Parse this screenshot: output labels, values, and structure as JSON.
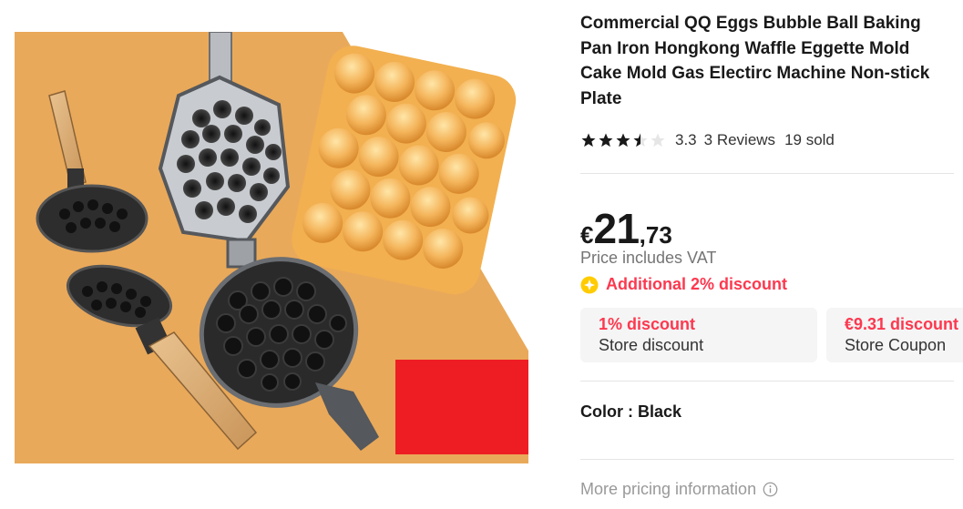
{
  "product": {
    "title": "Commercial QQ Eggs Bubble Ball Baking Pan Iron Hongkong Waffle Eggette Mold Cake Mold Gas Electirc Machine Non-stick Plate",
    "image_icon": "bubble-waffle-pan-photo"
  },
  "rating": {
    "value": "3.3",
    "stars": 3.3,
    "reviews": "3 Reviews",
    "sold": "19 sold",
    "star_color": "#191919",
    "empty_star_color": "#e6e6e6"
  },
  "price": {
    "currency": "€",
    "integer": "21",
    "decimal": ",73",
    "vat_note": "Price includes VAT"
  },
  "promo": {
    "additional_discount": "Additional 2% discount",
    "accent_color": "#fd384f",
    "coin_color": "#ffcc00"
  },
  "coupons": [
    {
      "title": "1% discount",
      "subtitle": "Store discount"
    },
    {
      "title": "€9.31 discount",
      "subtitle": "Store Coupon"
    }
  ],
  "variant": {
    "color_label": "Color : Black"
  },
  "footer": {
    "more_pricing": "More pricing information",
    "info_icon": "info-icon"
  }
}
